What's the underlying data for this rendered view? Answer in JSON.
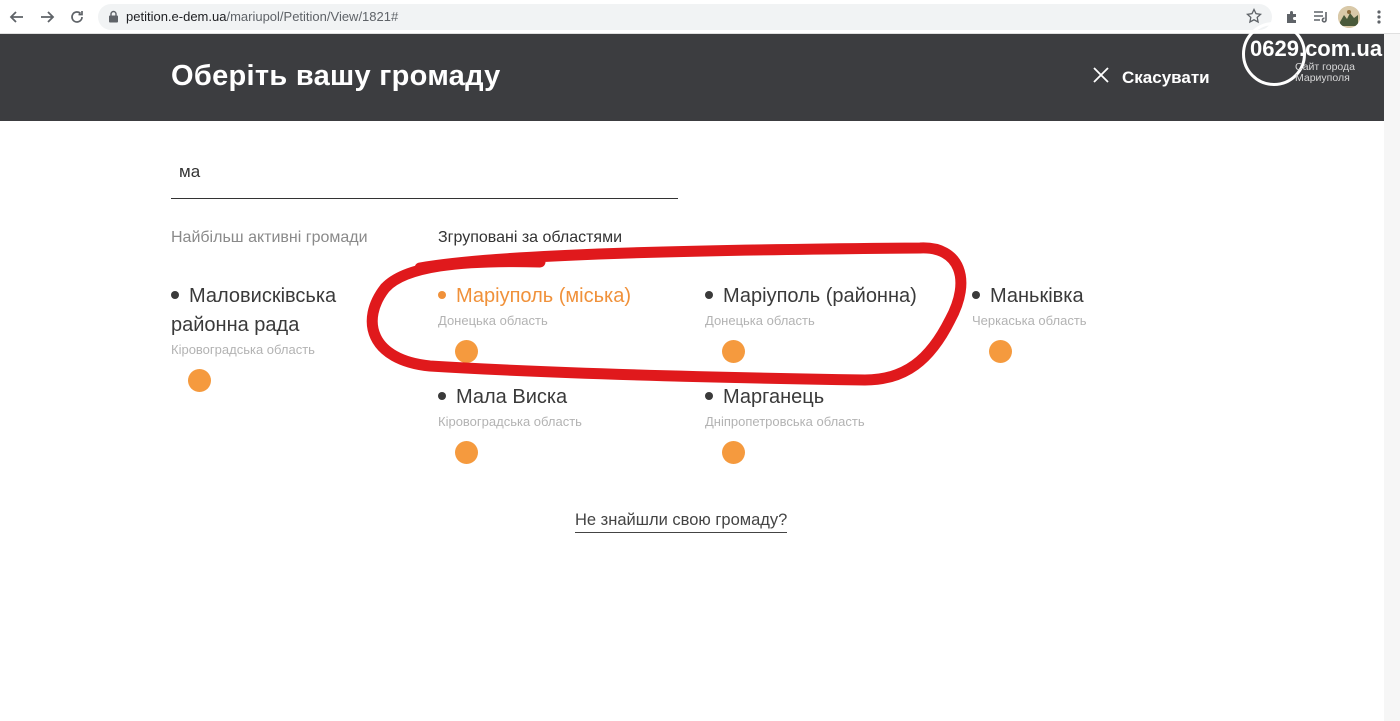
{
  "browser": {
    "url_host": "petition.e-dem.ua",
    "url_path": "/mariupol/Petition/View/1821#"
  },
  "site_logo": {
    "number": "0629",
    "domain": ".com.ua",
    "subtitle_line1": "Сайт города",
    "subtitle_line2": "Мариуполя"
  },
  "modal": {
    "title": "Оберіть вашу громаду",
    "cancel_label": "Скасувати"
  },
  "search": {
    "value": "ма"
  },
  "tabs": {
    "active_communities": "Найбільш активні громади",
    "grouped_by_region": "Згруповані за областями"
  },
  "communities": [
    {
      "title_line1": "Маловисківська",
      "title_line2": "районна рада",
      "region": "Кіровоградська область"
    },
    {
      "title": "Маріуполь (міська)",
      "region": "Донецька область",
      "highlighted": true
    },
    {
      "title": "Маріуполь (районна)",
      "region": "Донецька область"
    },
    {
      "title": "Маньківка",
      "region": "Черкаська область"
    },
    {
      "title": "Мала Виска",
      "region": "Кіровоградська область"
    },
    {
      "title": "Марганець",
      "region": "Дніпропетровська область"
    }
  ],
  "not_found_link": "Не знайшли свою громаду?",
  "colors": {
    "header_bg": "#3c3d40",
    "accent_orange": "#f0913a",
    "annotation_red": "#e0191c"
  }
}
